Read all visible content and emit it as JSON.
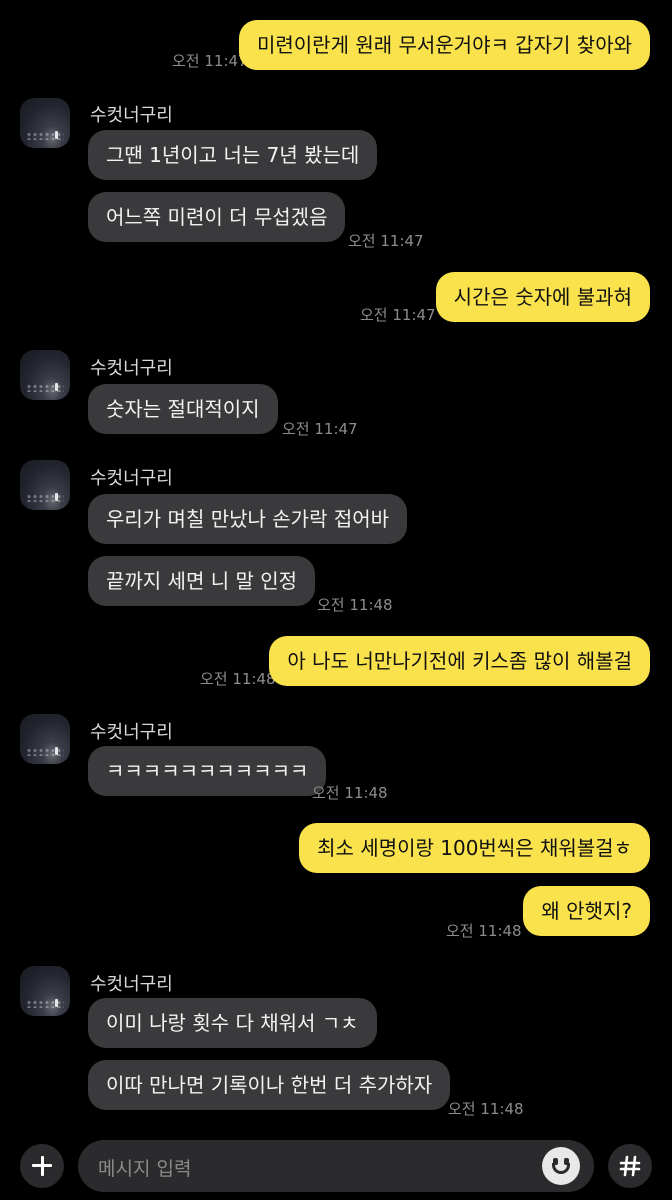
{
  "messages": [
    {
      "text": "미련이란게 원래 무서운거야ㅋ 갑자기 찾아와",
      "time": "오전 11:47"
    },
    {
      "sender": "수컷너구리",
      "text": "그땐 1년이고 너는 7년 봤는데"
    },
    {
      "text": "어느쪽 미련이 더 무섭겠음",
      "time": "오전 11:47"
    },
    {
      "text": "시간은 숫자에 불과혀",
      "time": "오전 11:47"
    },
    {
      "sender": "수컷너구리",
      "text": "숫자는 절대적이지",
      "time": "오전 11:47"
    },
    {
      "sender": "수컷너구리",
      "text": "우리가 며칠 만났나 손가락 접어바"
    },
    {
      "text": "끝까지 세면 니 말 인정",
      "time": "오전 11:48"
    },
    {
      "text": "아 나도 너만나기전에 키스좀 많이 해볼걸",
      "time": "오전 11:48"
    },
    {
      "sender": "수컷너구리",
      "text": "ㅋㅋㅋㅋㅋㅋㅋㅋㅋㅋㅋ",
      "time": "오전 11:48"
    },
    {
      "text": "최소 세명이랑 100번씩은 채워볼걸ㅎ"
    },
    {
      "text": "왜 안햇지?",
      "time": "오전 11:48"
    },
    {
      "sender": "수컷너구리",
      "text": "이미 나랑 횟수 다 채워서 ㄱㅊ"
    },
    {
      "text": "이따 만나면 기록이나 한번 더 추가하자",
      "time": "오전 11:48"
    }
  ],
  "composer": {
    "placeholder": "메시지 입력"
  },
  "colors": {
    "outgoing_bubble": "#f9e24b",
    "incoming_bubble": "#3a3a3c",
    "background": "#000000"
  },
  "icons": [
    "plus-icon",
    "emoji-icon",
    "hash-icon"
  ]
}
